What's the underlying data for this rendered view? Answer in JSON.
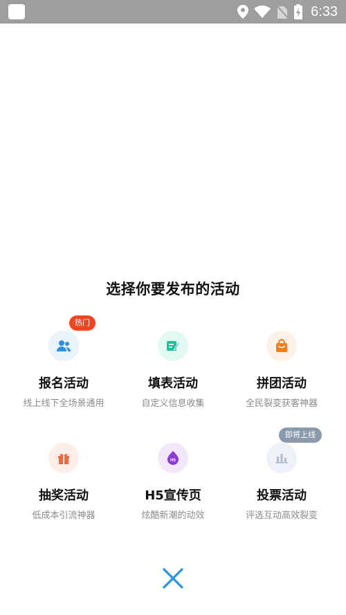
{
  "status_bar": {
    "time": "6:33"
  },
  "page": {
    "title": "选择你要发布的活动"
  },
  "activities": [
    {
      "title": "报名活动",
      "subtitle": "线上线下全场景通用",
      "badge": "热门",
      "icon": "people-icon"
    },
    {
      "title": "填表活动",
      "subtitle": "自定义信息收集",
      "badge": "",
      "icon": "form-pen-icon"
    },
    {
      "title": "拼团活动",
      "subtitle": "全民裂变获客神器",
      "badge": "",
      "icon": "shopping-bag-icon"
    },
    {
      "title": "抽奖活动",
      "subtitle": "低成本引流神器",
      "badge": "",
      "icon": "gift-icon"
    },
    {
      "title": "H5宣传页",
      "subtitle": "炫酷新潮的动效",
      "badge": "",
      "icon": "h5-icon"
    },
    {
      "title": "投票活动",
      "subtitle": "评选互动高效裂变",
      "badge": "即将上线",
      "icon": "bar-chart-icon"
    }
  ],
  "colors": {
    "statusbar": "#9e9e9e",
    "close": "#2196d9",
    "hot_badge": "#f0461e",
    "soon_badge": "#8a9aaa"
  }
}
